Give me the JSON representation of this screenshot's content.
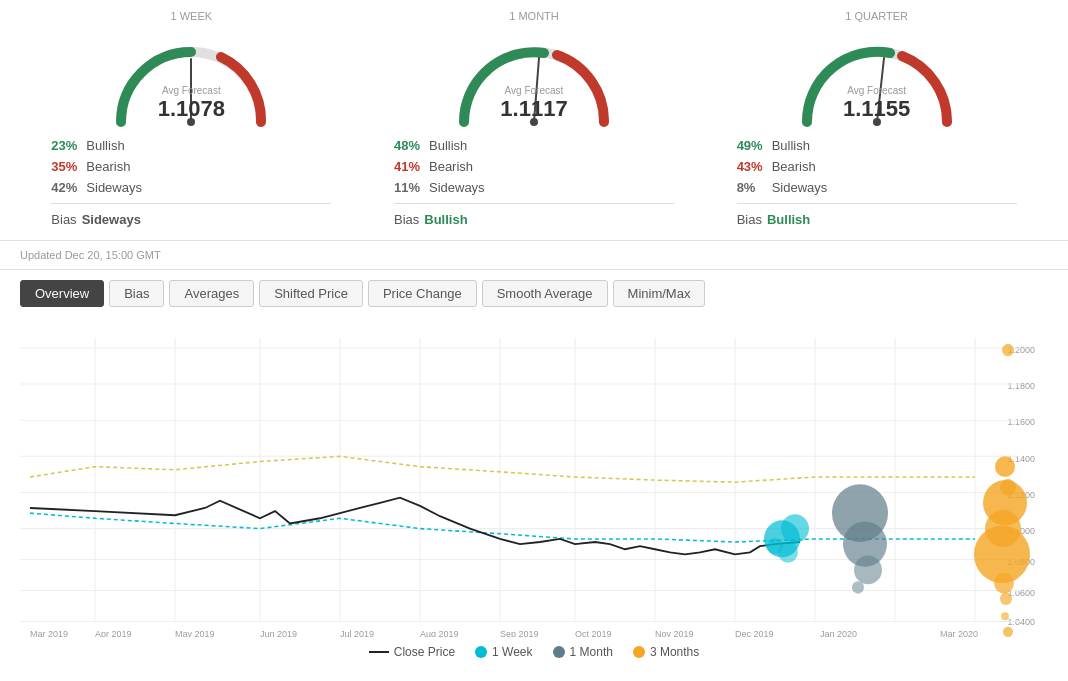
{
  "page": {
    "updated": "Updated Dec 20, 15:00 GMT"
  },
  "gauges": [
    {
      "period": "1 WEEK",
      "label": "Avg Forecast",
      "value": "1.1078",
      "bullish_pct": "23%",
      "bearish_pct": "35%",
      "sideways_pct": "42%",
      "bias_label": "Bias",
      "bias_value": "Sideways",
      "bias_class": "sideways"
    },
    {
      "period": "1 MONTH",
      "label": "Avg Forecast",
      "value": "1.1117",
      "bullish_pct": "48%",
      "bearish_pct": "41%",
      "sideways_pct": "11%",
      "bias_label": "Bias",
      "bias_value": "Bullish",
      "bias_class": "bullish"
    },
    {
      "period": "1 QUARTER",
      "label": "Avg Forecast",
      "value": "1.1155",
      "bullish_pct": "49%",
      "bearish_pct": "43%",
      "sideways_pct": "8%",
      "bias_label": "Bias",
      "bias_value": "Bullish",
      "bias_class": "bullish"
    }
  ],
  "tabs": [
    {
      "id": "overview",
      "label": "Overview",
      "active": true
    },
    {
      "id": "bias",
      "label": "Bias",
      "active": false
    },
    {
      "id": "averages",
      "label": "Averages",
      "active": false
    },
    {
      "id": "shifted-price",
      "label": "Shifted Price",
      "active": false
    },
    {
      "id": "price-change",
      "label": "Price Change",
      "active": false
    },
    {
      "id": "smooth-average",
      "label": "Smooth Average",
      "active": false
    },
    {
      "id": "minim-max",
      "label": "Minim/Max",
      "active": false
    }
  ],
  "chart": {
    "x_labels": [
      "Mar 2019",
      "Apr 2019",
      "May 2019",
      "Jun 2019",
      "Jul 2019",
      "Aug 2019",
      "Sep 2019",
      "Oct 2019",
      "Nov 2019",
      "Dec 2019",
      "Jan 2020",
      "Mar 2020"
    ],
    "y_labels": [
      "1.0400",
      "1.0600",
      "1.0800",
      "1.1000",
      "1.1200",
      "1.1400",
      "1.1600",
      "1.1800",
      "1.2000"
    ],
    "y_min": 1.04,
    "y_max": 1.2
  },
  "legend": [
    {
      "id": "close-price",
      "label": "Close Price",
      "color": "#222",
      "type": "line"
    },
    {
      "id": "1week",
      "label": "1 Week",
      "color": "#00bcd4",
      "type": "dot"
    },
    {
      "id": "1month",
      "label": "1 Month",
      "color": "#607d8b",
      "type": "dot"
    },
    {
      "id": "3months",
      "label": "3 Months",
      "color": "#f5a623",
      "type": "dot"
    }
  ]
}
